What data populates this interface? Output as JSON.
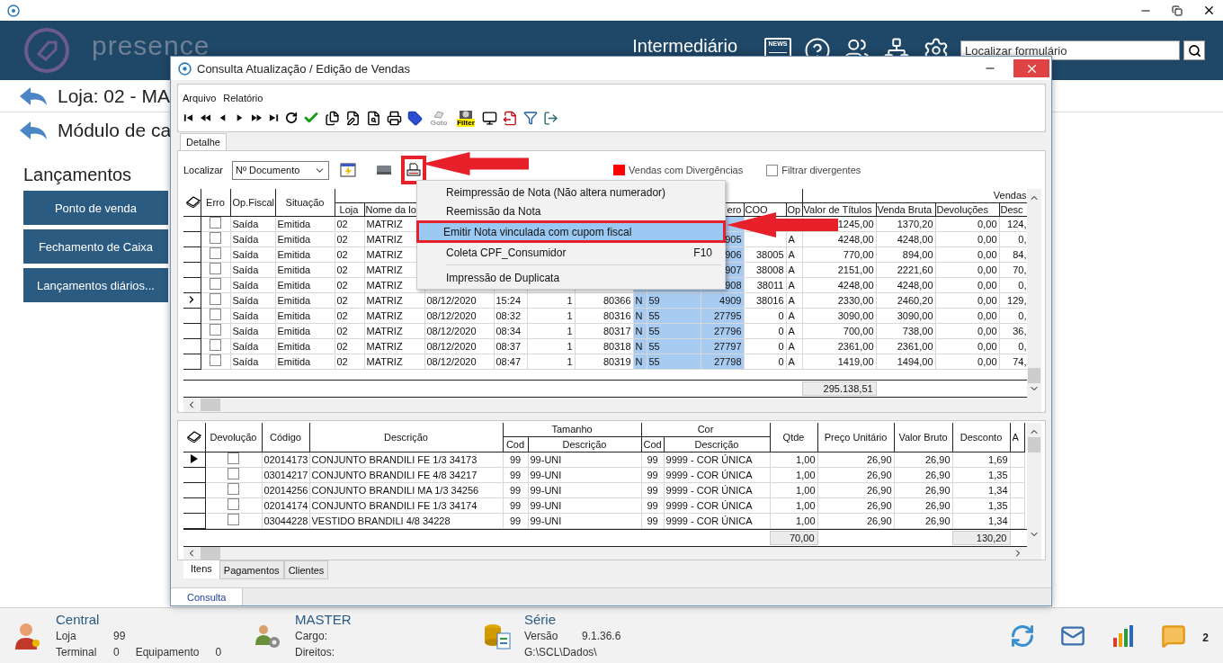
{
  "header": {
    "logo": "presence",
    "level": "Intermediário",
    "icons": [
      {
        "kind": "news",
        "label": "NEWS"
      },
      {
        "kind": "help"
      },
      {
        "kind": "people"
      },
      {
        "kind": "network"
      },
      {
        "kind": "settings"
      }
    ],
    "search": {
      "placeholder": "Localizar formulário"
    }
  },
  "store": {
    "title": "Loja: 02 - MA"
  },
  "module": {
    "title": "Módulo de ca"
  },
  "section": "Lançamentos",
  "nav_buttons": [
    "Ponto de venda",
    "Fechamento de Caixa",
    "Lançamentos diários..."
  ],
  "dialog": {
    "title": "Consulta Atualização / Edição de Vendas",
    "menu": [
      "Arquivo",
      "Relatório"
    ],
    "toolbar": [
      {
        "kind": "first"
      },
      {
        "kind": "rewind"
      },
      {
        "kind": "previous"
      },
      {
        "kind": "next"
      },
      {
        "kind": "forward"
      },
      {
        "kind": "last"
      },
      {
        "kind": "refresh"
      },
      {
        "kind": "confirm"
      },
      {
        "kind": "copy"
      },
      {
        "kind": "edit"
      },
      {
        "kind": "preview"
      },
      {
        "kind": "print"
      },
      {
        "kind": "tag"
      },
      {
        "kind": "goto",
        "label": "Goto"
      },
      {
        "kind": "filter_view",
        "label": "Filter"
      },
      {
        "kind": "monitor"
      },
      {
        "kind": "export"
      },
      {
        "kind": "filter"
      },
      {
        "kind": "exit"
      }
    ],
    "tabs": [
      {
        "label": "Detalhe",
        "selected": true
      }
    ],
    "search": {
      "label": "Localizar",
      "value": "Nº Documento"
    },
    "legend": {
      "label": "Vendas com Divergências"
    },
    "filter_divergent": {
      "label": "Filtrar divergentes",
      "checked": false
    },
    "sales_table": {
      "group": "Vendas",
      "error_column": "Erro",
      "columns": [
        "Op.Fiscal",
        "Situação",
        "Loja",
        "Nome da lo",
        null,
        null,
        null,
        null,
        null,
        null,
        "ero",
        "COO",
        "Op",
        "Valor de Títulos",
        "Venda Bruta",
        "Devoluções",
        "Desc"
      ],
      "rows": [
        {
          "selected": false,
          "error": false,
          "cells": [
            "Saída",
            "Emitida",
            "02",
            "MATRIZ",
            null,
            null,
            null,
            null,
            null,
            null,
            null,
            null,
            null,
            "1245,00",
            "1370,20",
            "0,00",
            "124,"
          ]
        },
        {
          "selected": false,
          "error": false,
          "cells": [
            "Saída",
            "Emitida",
            "02",
            "MATRIZ",
            null,
            null,
            null,
            null,
            null,
            null,
            "905",
            null,
            "A",
            "4248,00",
            "4248,00",
            "0,00",
            "0,"
          ]
        },
        {
          "selected": false,
          "error": false,
          "cells": [
            "Saída",
            "Emitida",
            "02",
            "MATRIZ",
            null,
            null,
            null,
            null,
            null,
            null,
            "906",
            "38005",
            "A",
            "770,00",
            "894,00",
            "0,00",
            "84,"
          ]
        },
        {
          "selected": false,
          "error": false,
          "cells": [
            "Saída",
            "Emitida",
            "02",
            "MATRIZ",
            null,
            null,
            null,
            null,
            null,
            null,
            "907",
            "38008",
            "A",
            "2151,00",
            "2221,60",
            "0,00",
            "70,"
          ]
        },
        {
          "selected": false,
          "error": false,
          "cells": [
            "Saída",
            "Emitida",
            "02",
            "MATRIZ",
            null,
            null,
            null,
            null,
            null,
            null,
            "908",
            "38011",
            "A",
            "4248,00",
            "4248,00",
            "0,00",
            "0,"
          ]
        },
        {
          "selected": true,
          "error": false,
          "cells": [
            "Saída",
            "Emitida",
            "02",
            "MATRIZ",
            "08/12/2020",
            "15:24",
            "1",
            "80366",
            "N",
            "59",
            "4909",
            "38016",
            "A",
            "2330,00",
            "2460,20",
            "0,00",
            "129,"
          ]
        },
        {
          "selected": false,
          "error": false,
          "cells": [
            "Saída",
            "Emitida",
            "02",
            "MATRIZ",
            "08/12/2020",
            "08:32",
            "1",
            "80316",
            "N",
            "55",
            "27795",
            "0",
            "A",
            "3090,00",
            "3090,00",
            "0,00",
            "0,"
          ]
        },
        {
          "selected": false,
          "error": false,
          "cells": [
            "Saída",
            "Emitida",
            "02",
            "MATRIZ",
            "08/12/2020",
            "08:34",
            "1",
            "80317",
            "N",
            "55",
            "27796",
            "0",
            "A",
            "700,00",
            "738,00",
            "0,00",
            "36,"
          ]
        },
        {
          "selected": false,
          "error": false,
          "cells": [
            "Saída",
            "Emitida",
            "02",
            "MATRIZ",
            "08/12/2020",
            "08:37",
            "1",
            "80318",
            "N",
            "55",
            "27797",
            "0",
            "A",
            "2361,00",
            "2361,00",
            "0,00",
            "0,"
          ]
        },
        {
          "selected": false,
          "error": false,
          "cells": [
            "Saída",
            "Emitida",
            "02",
            "MATRIZ",
            "08/12/2020",
            "08:47",
            "1",
            "80319",
            "N",
            "55",
            "27798",
            "0",
            "A",
            "1419,00",
            "1494,00",
            "0,00",
            "74,"
          ]
        }
      ],
      "total": "295.138,51"
    },
    "context_menu": [
      {
        "kind": "item",
        "label": "Reimpressão de Nota (Não altera numerador)",
        "selected": false
      },
      {
        "kind": "item",
        "label": "Reemissão da Nota",
        "selected": false
      },
      {
        "kind": "item",
        "label": "Emitir Nota vinculada com cupom fiscal",
        "selected": true
      },
      {
        "kind": "item",
        "label": "Coleta CPF_Consumidor",
        "shortcut": "F10",
        "selected": false
      },
      {
        "kind": "separator"
      },
      {
        "kind": "item",
        "label": "Impressão de Duplicata",
        "selected": false
      }
    ],
    "items_table": {
      "groups": [
        "Tamanho",
        "Cor"
      ],
      "returned_column": "Devolução",
      "columns": [
        "Código",
        "Descrição",
        "Cod",
        "Descrição",
        "Cod",
        "Descrição",
        "Qtde",
        "Preço Unitário",
        "Valor Bruto",
        "Desconto",
        "A"
      ],
      "rows": [
        {
          "selected": true,
          "returned": false,
          "cells": [
            "02014173",
            "CONJUNTO BRANDILI FE 1/3 34173",
            "99",
            "99-UNI",
            "99",
            "9999 - COR ÚNICA",
            "1,00",
            "26,90",
            "26,90",
            "1,69"
          ]
        },
        {
          "selected": false,
          "returned": false,
          "cells": [
            "03014217",
            "CONJUNTO BRANDILI FE 4/8 34217",
            "99",
            "99-UNI",
            "99",
            "9999 - COR ÚNICA",
            "1,00",
            "26,90",
            "26,90",
            "1,35"
          ]
        },
        {
          "selected": false,
          "returned": false,
          "cells": [
            "02014256",
            "CONJUNTO BRANDILI MA 1/3 34256",
            "99",
            "99-UNI",
            "99",
            "9999 - COR ÚNICA",
            "1,00",
            "26,90",
            "26,90",
            "1,34"
          ]
        },
        {
          "selected": false,
          "returned": false,
          "cells": [
            "02014174",
            "CONJUNTO BRANDILI FE 1/3 34174",
            "99",
            "99-UNI",
            "99",
            "9999 - COR ÚNICA",
            "1,00",
            "26,90",
            "26,90",
            "1,35"
          ]
        },
        {
          "selected": false,
          "returned": false,
          "cells": [
            "03044228",
            "VESTIDO BRANDILI 4/8 34228",
            "99",
            "99-UNI",
            "99",
            "9999 - COR ÚNICA",
            "1,00",
            "26,90",
            "26,90",
            "1,34"
          ]
        }
      ],
      "total_qty": "70,00",
      "total_discount": "130,20"
    },
    "detail_tabs": [
      {
        "label": "Itens",
        "selected": true
      },
      {
        "label": "Pagamentos",
        "selected": false
      },
      {
        "label": "Clientes",
        "selected": false
      }
    ],
    "view_tabs": [
      {
        "label": "Consulta",
        "selected": true
      }
    ]
  },
  "status_bar": {
    "groups": [
      {
        "kind": "user",
        "title": "Central",
        "lines": [
          [
            "Loja",
            "99"
          ],
          [
            "Terminal",
            "0",
            "Equipamento",
            "0"
          ]
        ]
      },
      {
        "kind": "team",
        "title": "MASTER",
        "lines": [
          [
            "Cargo:"
          ],
          [
            "Direitos:"
          ]
        ]
      },
      {
        "kind": "database",
        "title": "Série",
        "lines": [
          [
            "Versão",
            "9.1.36.6"
          ],
          [
            "G:\\SCL\\Dados\\"
          ]
        ]
      }
    ],
    "notifications": "2"
  }
}
